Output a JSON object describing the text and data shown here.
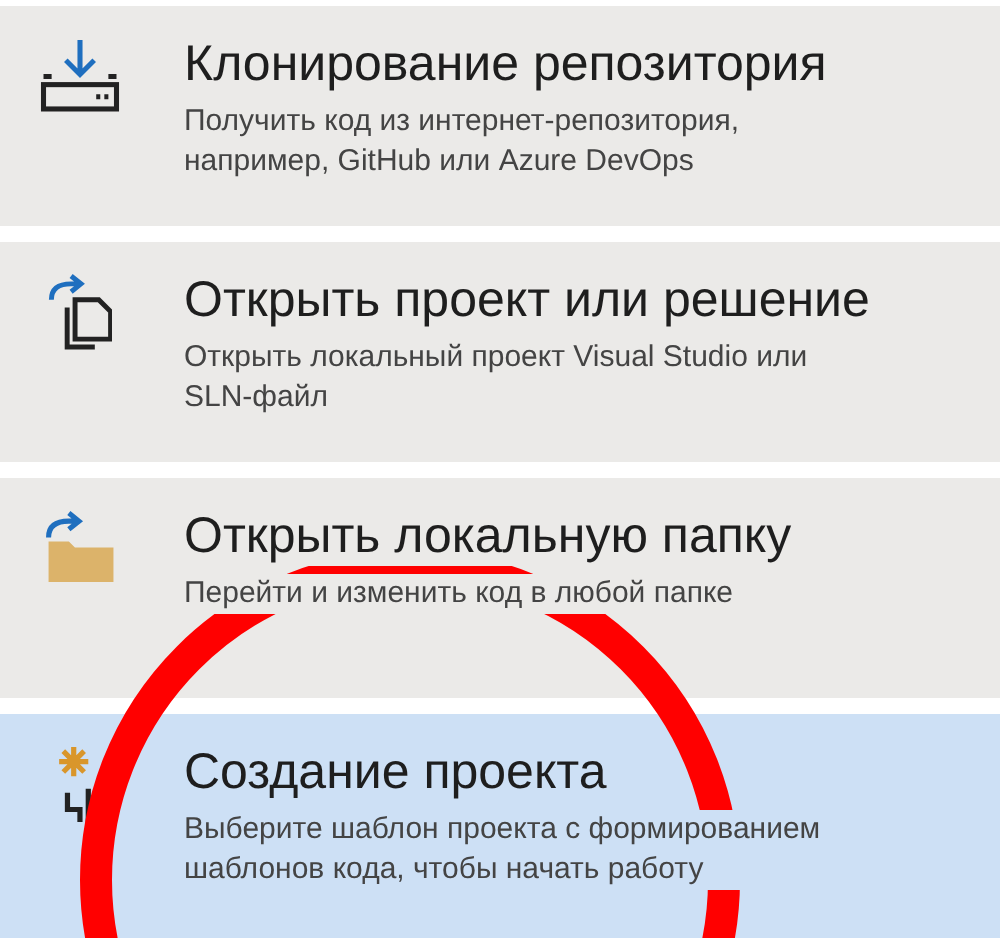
{
  "actions": [
    {
      "kind": "clone",
      "title": "Клонирование репозитория",
      "description": "Получить код из интернет-репозитория, например, GitHub или Azure DevOps",
      "selected": false
    },
    {
      "kind": "open-project",
      "title": "Открыть проект или решение",
      "description": "Открыть локальный проект Visual Studio или SLN-файл",
      "selected": false
    },
    {
      "kind": "open-folder",
      "title": "Открыть локальную папку",
      "description": "Перейти и изменить код в любой папке",
      "selected": false
    },
    {
      "kind": "new-project",
      "title": "Создание проекта",
      "description": "Выберите шаблон проекта с формированием шаблонов кода, чтобы начать работу",
      "selected": true
    }
  ]
}
